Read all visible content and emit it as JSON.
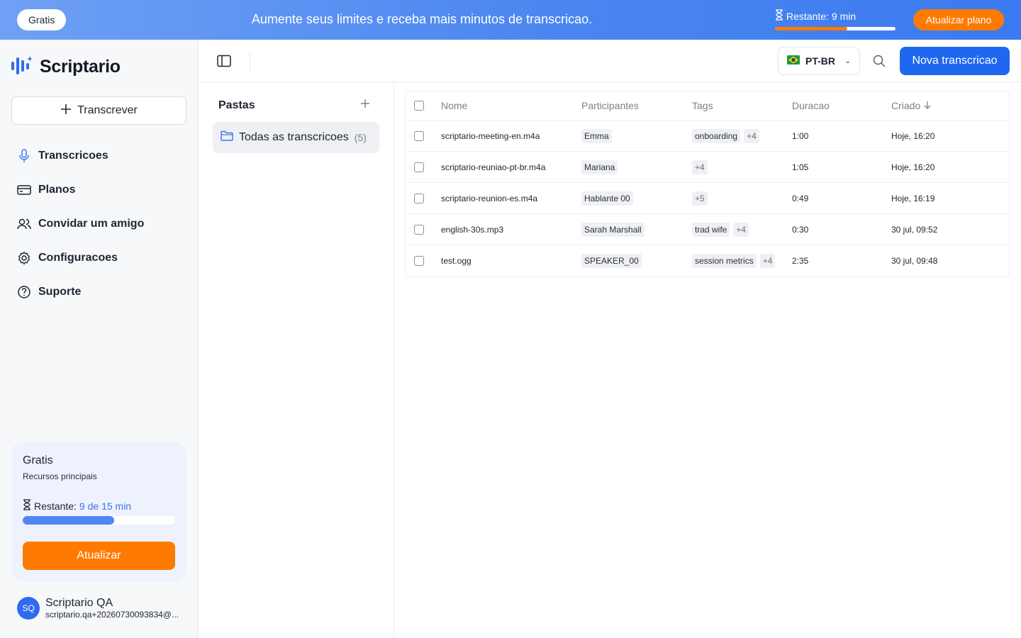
{
  "banner": {
    "plan_label": "Gratis",
    "message": "Aumente seus limites e receba mais minutos de transcricao.",
    "remaining_label": "Restante:",
    "remaining_value": "9 min",
    "remaining_fraction": 0.6,
    "upgrade_button": "Atualizar plano"
  },
  "sidebar": {
    "app_name": "Scriptario",
    "transcribe_button": "Transcrever",
    "nav": [
      {
        "label": "Transcricoes",
        "icon": "microphone-icon"
      },
      {
        "label": "Planos",
        "icon": "card-icon"
      },
      {
        "label": "Convidar um amigo",
        "icon": "users-icon"
      },
      {
        "label": "Configuracoes",
        "icon": "gear-icon"
      },
      {
        "label": "Suporte",
        "icon": "help-icon"
      }
    ],
    "plan_card": {
      "title": "Gratis",
      "subtitle": "Recursos principais",
      "remaining_label": "Restante:",
      "remaining_value": "9 de 15 min",
      "remaining_fraction": 0.6,
      "button": "Atualizar"
    },
    "user": {
      "initials": "SQ",
      "name": "Scriptario QA",
      "email": "scriptario.qa+20260730093834@..."
    }
  },
  "toolbar": {
    "language": "PT-BR",
    "new_button": "Nova transcricao"
  },
  "folders": {
    "heading": "Pastas",
    "items": [
      {
        "label": "Todas as transcricoes",
        "count": "(5)"
      }
    ]
  },
  "table": {
    "columns": {
      "name": "Nome",
      "participants": "Participantes",
      "tags": "Tags",
      "duration": "Duracao",
      "created": "Criado"
    },
    "rows": [
      {
        "name": "scriptario-meeting-en.m4a",
        "participant": "Emma",
        "tag": "onboarding",
        "more": "+4",
        "duration": "1:00",
        "created": "Hoje, 16:20"
      },
      {
        "name": "scriptario-reuniao-pt-br.m4a",
        "participant": "Mariana",
        "tag": "",
        "more": "+4",
        "duration": "1:05",
        "created": "Hoje, 16:20"
      },
      {
        "name": "scriptario-reunion-es.m4a",
        "participant": "Hablante 00",
        "tag": "",
        "more": "+5",
        "duration": "0:49",
        "created": "Hoje, 16:19"
      },
      {
        "name": "english-30s.mp3",
        "participant": "Sarah Marshall",
        "tag": "trad wife",
        "more": "+4",
        "duration": "0:30",
        "created": "30 jul, 09:52"
      },
      {
        "name": "test.ogg",
        "participant": "SPEAKER_00",
        "tag": "session metrics",
        "more": "+4",
        "duration": "2:35",
        "created": "30 jul, 09:48"
      }
    ]
  }
}
